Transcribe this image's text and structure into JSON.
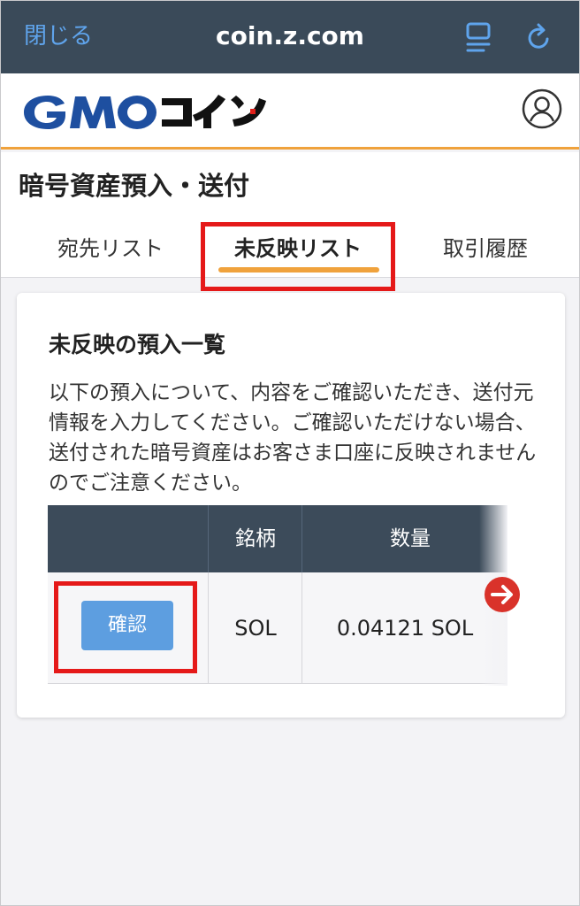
{
  "browser": {
    "close_label": "閉じる",
    "url": "coin.z.com"
  },
  "header": {
    "logo_text": "GMOコイン"
  },
  "page": {
    "title": "暗号資産預入・送付"
  },
  "tabs": [
    {
      "label": "宛先リスト",
      "active": false
    },
    {
      "label": "未反映リスト",
      "active": true
    },
    {
      "label": "取引履歴",
      "active": false
    }
  ],
  "card": {
    "title": "未反映の預入一覧",
    "description": "以下の預入について、内容をご確認いただき、送付元情報を入力してください。ご確認いただけない場合、送付された暗号資産はお客さま口座に反映されませんのでご注意ください。"
  },
  "table": {
    "headers": [
      "",
      "銘柄",
      "数量"
    ],
    "rows": [
      {
        "action_label": "確認",
        "symbol": "SOL",
        "quantity": "0.04121 SOL"
      }
    ]
  },
  "colors": {
    "topbar": "#3a4a59",
    "accent_orange": "#f0a23c",
    "highlight_red": "#e51919",
    "button_blue": "#5d9ee0",
    "table_header": "#3c4b5a"
  },
  "icons": [
    "reader-icon",
    "reload-icon",
    "user-icon",
    "arrow-right-icon"
  ]
}
